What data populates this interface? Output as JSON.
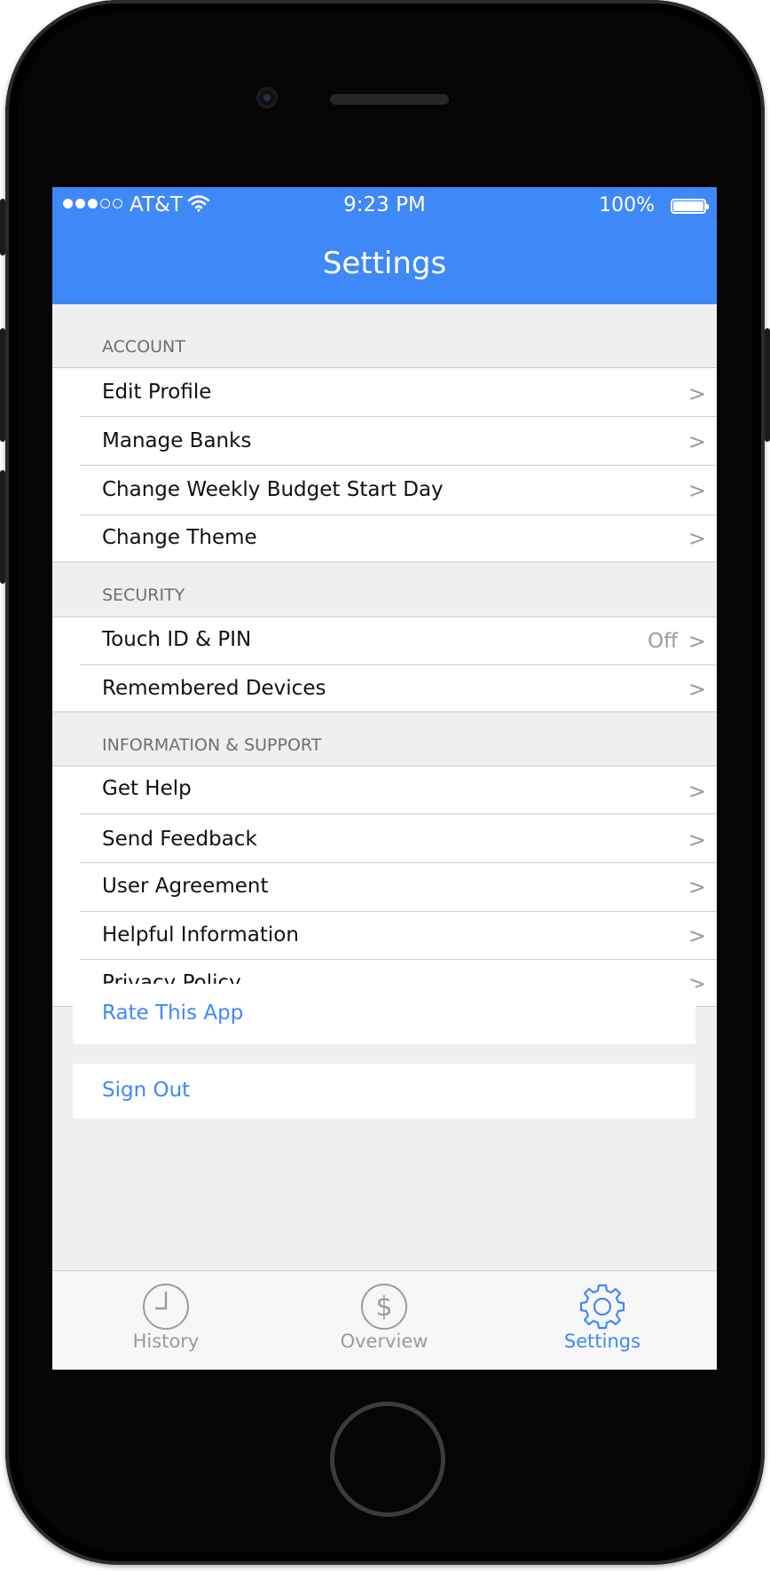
{
  "status_bar": {
    "carrier": "AT&T",
    "time": "9:23 PM",
    "battery": "100%"
  },
  "nav": {
    "title": "Settings"
  },
  "sections": [
    {
      "header": "ACCOUNT",
      "items": [
        {
          "label": "Edit Profile",
          "value": ""
        },
        {
          "label": "Manage Banks",
          "value": ""
        },
        {
          "label": "Change Weekly Budget Start Day",
          "value": ""
        },
        {
          "label": "Change Theme",
          "value": ""
        }
      ]
    },
    {
      "header": "SECURITY",
      "items": [
        {
          "label": "Touch ID & PIN",
          "value": "Off"
        },
        {
          "label": "Remembered Devices",
          "value": ""
        }
      ]
    },
    {
      "header": "INFORMATION & SUPPORT",
      "items": [
        {
          "label": "Get Help",
          "value": ""
        },
        {
          "label": "Send Feedback",
          "value": ""
        },
        {
          "label": "User Agreement",
          "value": ""
        },
        {
          "label": "Helpful Information",
          "value": ""
        },
        {
          "label": "Privacy Policy",
          "value": ""
        }
      ]
    }
  ],
  "chevron": ">",
  "actions": {
    "rate": "Rate This App",
    "sign_out": "Sign Out"
  },
  "tabs": [
    {
      "label": "History",
      "icon": "clock-icon",
      "active": false
    },
    {
      "label": "Overview",
      "icon": "dollar-icon",
      "active": false
    },
    {
      "label": "Settings",
      "icon": "gear-icon",
      "active": true
    }
  ],
  "colors": {
    "accent": "#3f88f8",
    "background": "#efefef",
    "inactive": "#9b9b9b"
  }
}
